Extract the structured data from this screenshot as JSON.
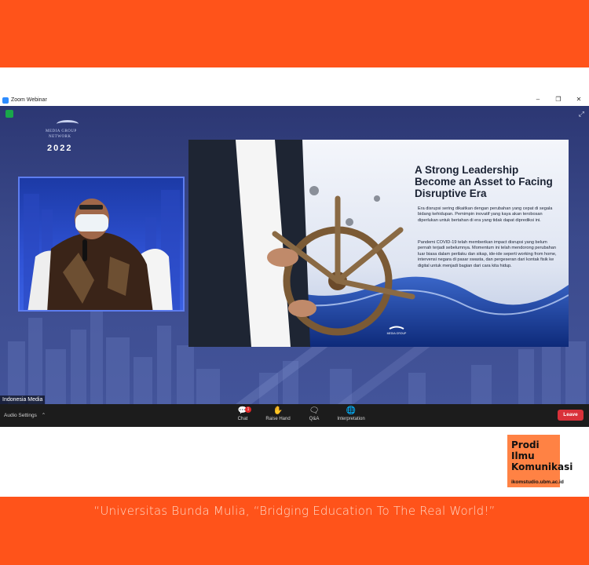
{
  "window": {
    "title": "Zoom Webinar",
    "controls": [
      "–",
      "❐",
      "✕"
    ]
  },
  "event_logo": {
    "line1": "MEDIA GROUP",
    "line2": "NETWORK",
    "year": "2022"
  },
  "slide": {
    "title": "A Strong Leadership Become an Asset to Facing Disruptive Era",
    "paragraph1": "Era disrupsi sering dikaitkan dengan perubahan yang cepat di segala bidang kehidupan. Pemimpin inovatif yang kaya akan terobosan diperlukan untuk bertahan di era yang tidak dapat diprediksi ini.",
    "paragraph2": "Pandemi COVID-19 telah memberikan impact disrupsi yang belum pernah terjadi sebelumnya. Momentum ini telah mendorong perubahan luar biasa dalam perilaku dan sikap, ide-ide seperti working from home, intervensi negara di pasar swasta, dan pergeseran dari kontak fisik ke digital untuk menjadi bagian dari cara kita hidup.",
    "footer_logo": "MEDIA GROUP"
  },
  "speaker_label": "Indonesia Media",
  "toolbar": {
    "audio_settings": "Audio Settings",
    "items": [
      {
        "label": "Chat",
        "icon": "chat-icon",
        "badge": "1"
      },
      {
        "label": "Raise Hand",
        "icon": "raise-hand-icon"
      },
      {
        "label": "Q&A",
        "icon": "qa-icon"
      },
      {
        "label": "Interpretation",
        "icon": "globe-icon"
      }
    ],
    "leave": "Leave"
  },
  "brand": {
    "lines": [
      "Prodi",
      "Ilmu",
      "Komunikasi"
    ],
    "url": "ikomstudio.ubm.ac.id"
  },
  "tagline": "“Universitas Bunda Mulia, “Bridging Education To The Real World!”",
  "colors": {
    "band": "#ff531a",
    "brand_box": "#ff8244",
    "leave": "#d9313a",
    "zoom_blue": "#2d8cff"
  }
}
